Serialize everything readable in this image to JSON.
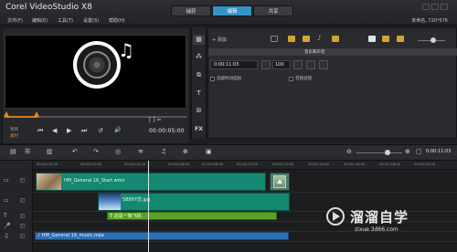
{
  "app": {
    "title": "Corel VideoStudio X8"
  },
  "menu": [
    "文件(F)",
    "编辑(E)",
    "工具(T)",
    "设置(S)",
    "帮助(H)"
  ],
  "tabs": [
    {
      "label": "捕获",
      "active": false
    },
    {
      "label": "编辑",
      "active": true
    },
    {
      "label": "共享",
      "active": false
    }
  ],
  "project_info": "未命名, 720*576",
  "preview": {
    "mode_project": "项目",
    "mode_clip": "素材",
    "timecode": "00:00:05:00",
    "buttons": [
      "⏮",
      "◀",
      "▶",
      "⏭",
      "↺",
      "🔊"
    ],
    "range_markers": "[  ]  ✂",
    "scrub_progress": 0.18
  },
  "library": {
    "add_label": "添加",
    "side_icons": [
      {
        "glyph": "▦",
        "name": "media-icon"
      },
      {
        "glyph": "⁂",
        "name": "instant-project-icon"
      },
      {
        "glyph": "⧉",
        "name": "transition-icon"
      },
      {
        "glyph": "T",
        "name": "title-icon"
      },
      {
        "glyph": "⊞",
        "name": "graphic-icon"
      },
      {
        "glyph": "FX",
        "name": "filter-icon"
      }
    ]
  },
  "options": {
    "header": "音乐和声音",
    "duration": "0:00:11:03",
    "volume": "100",
    "fade_in_label": "选取时间成组",
    "fade_out_label": "音频滤镜"
  },
  "timeline": {
    "timecode": "0:00:11:03",
    "zoom_level": 0.62,
    "ruler_labels": [
      "00:00:00:00",
      "00:00:02:00",
      "00:00:04:00",
      "00:00:06:00",
      "00:00:08:00",
      "00:00:10:00",
      "00:00:12:00",
      "00:00:14:00",
      "00:00:16:00",
      "00:00:18:00",
      "00:00:20:00"
    ],
    "clips": {
      "video": "HM_General 16_Start.wmv",
      "overlay": "58897仿.jpg",
      "title": "T 这是一架飞机",
      "music": "♪ HM_General 16_music.mpa"
    }
  },
  "watermark": {
    "title": "溜溜自学",
    "url": "zixue.3d66.com"
  },
  "colors": {
    "accent": "#3594c7",
    "video_clip": "#138872",
    "title_clip": "#5aa329",
    "music_clip": "#2f6fb5",
    "trim_marker": "#e08a28"
  }
}
